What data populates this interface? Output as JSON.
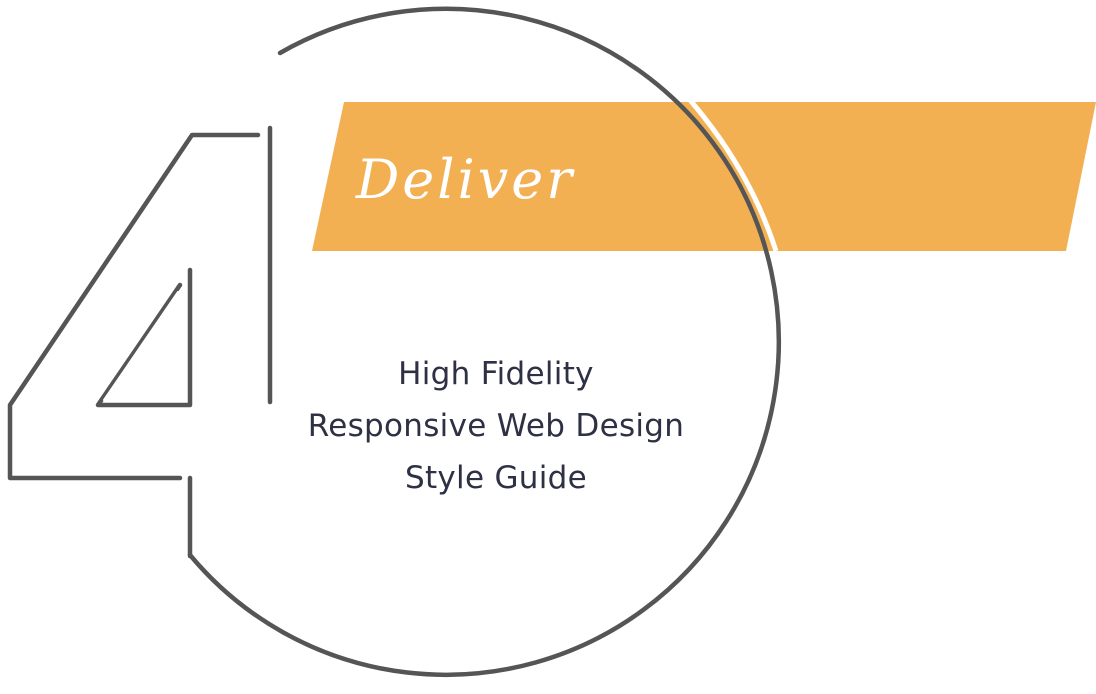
{
  "step": {
    "number": "4",
    "title": "Deliver",
    "items": [
      "High Fidelity",
      "Responsive Web Design",
      "Style Guide"
    ]
  },
  "colors": {
    "banner": "#f2b052",
    "outline": "#555555",
    "text": "#2e3044"
  }
}
